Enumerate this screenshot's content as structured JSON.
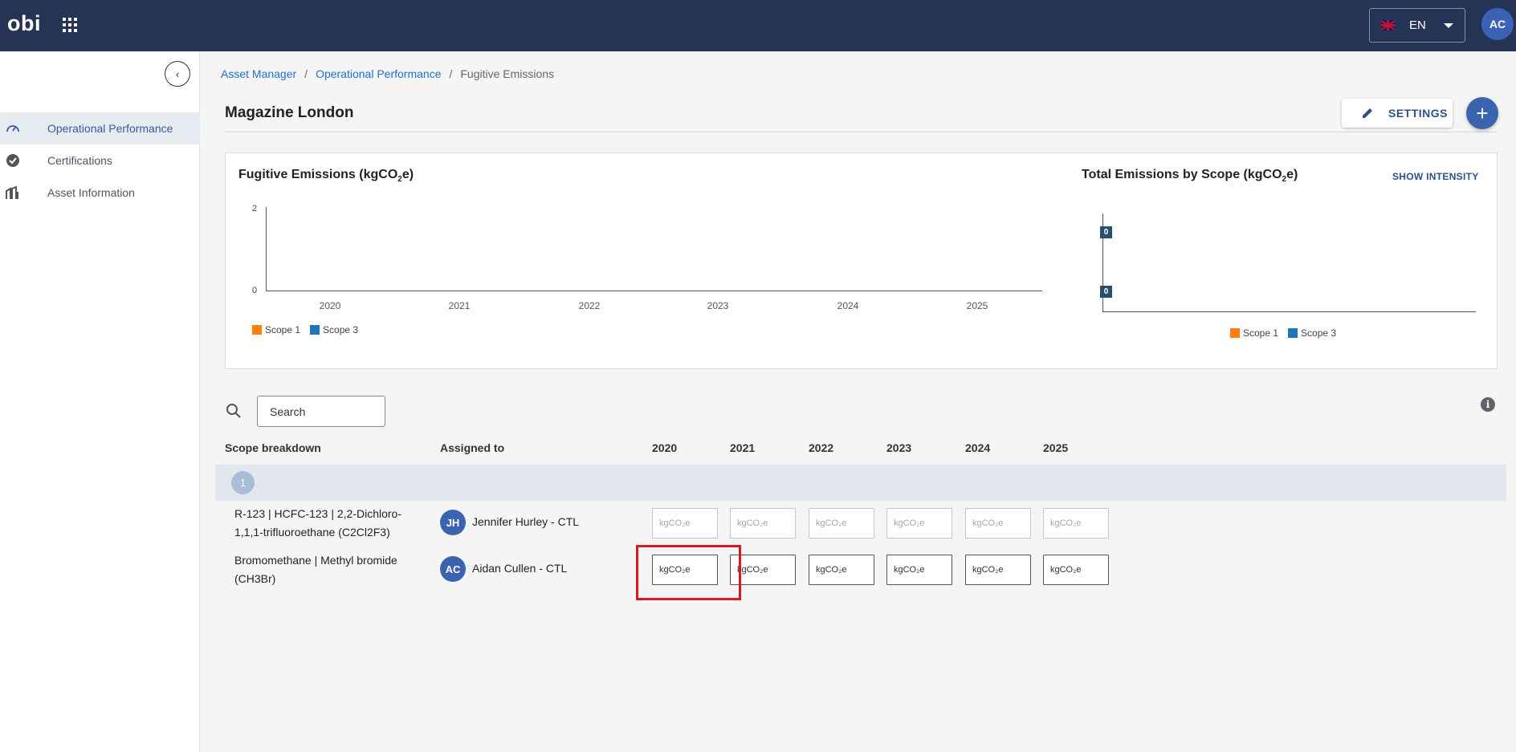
{
  "topbar": {
    "logo": "obi",
    "language": "EN",
    "user_initials": "AC"
  },
  "sidebar": {
    "items": [
      {
        "label": "Operational Performance",
        "icon": "gauge-icon",
        "active": true
      },
      {
        "label": "Certifications",
        "icon": "badge-check-icon",
        "active": false
      },
      {
        "label": "Asset Information",
        "icon": "building-icon",
        "active": false
      }
    ]
  },
  "breadcrumb": {
    "items": [
      "Asset Manager",
      "Operational Performance",
      "Fugitive Emissions"
    ],
    "separator": "/"
  },
  "page": {
    "title": "Magazine London",
    "settings_label": "SETTINGS",
    "add_label": "+"
  },
  "charts": {
    "left_title": "Fugitive Emissions (kgCO",
    "left_title_sub": "2",
    "left_title_end": "e)",
    "right_title": "Total Emissions by Scope (kgCO",
    "right_title_sub": "2",
    "right_title_end": "e)",
    "show_intensity": "SHOW INTENSITY",
    "legend": [
      "Scope 1",
      "Scope 3"
    ],
    "colors": {
      "scope1": "#ff7f0e",
      "scope3": "#1f77b4"
    }
  },
  "chart_data": [
    {
      "type": "bar",
      "title": "Fugitive Emissions (kgCO2e)",
      "categories": [
        "2020",
        "2021",
        "2022",
        "2023",
        "2024",
        "2025"
      ],
      "series": [
        {
          "name": "Scope 1",
          "values": [
            0,
            0,
            0,
            0,
            0,
            0
          ]
        },
        {
          "name": "Scope 3",
          "values": [
            0,
            0,
            0,
            0,
            0,
            0
          ]
        }
      ],
      "yticks": [
        "2",
        "0"
      ],
      "ylim": [
        0,
        2
      ],
      "legend": "bottom-left"
    },
    {
      "type": "bar",
      "title": "Total Emissions by Scope (kgCO2e)",
      "series": [
        {
          "name": "Scope 1",
          "values": [
            0
          ]
        },
        {
          "name": "Scope 3",
          "values": [
            0
          ]
        }
      ],
      "data_labels": [
        "0",
        "0"
      ],
      "legend": "bottom-center"
    }
  ],
  "search": {
    "placeholder": "Search"
  },
  "table": {
    "headers": {
      "scope": "Scope breakdown",
      "assigned": "Assigned to",
      "years": [
        "2020",
        "2021",
        "2022",
        "2023",
        "2024",
        "2025"
      ]
    },
    "group": {
      "label": "1"
    },
    "unit_placeholder": "kgCO₂e",
    "rows": [
      {
        "name": "R-123 | HCFC-123 | 2,2-Dichloro-1,1,1-trifluoroethane (C2Cl2F3)",
        "initials": "JH",
        "assignee": "Jennifer Hurley - CTL",
        "enabled": false
      },
      {
        "name": "Bromomethane | Methyl bromide (CH3Br)",
        "initials": "AC",
        "assignee": "Aidan Cullen - CTL",
        "enabled": true
      }
    ]
  }
}
